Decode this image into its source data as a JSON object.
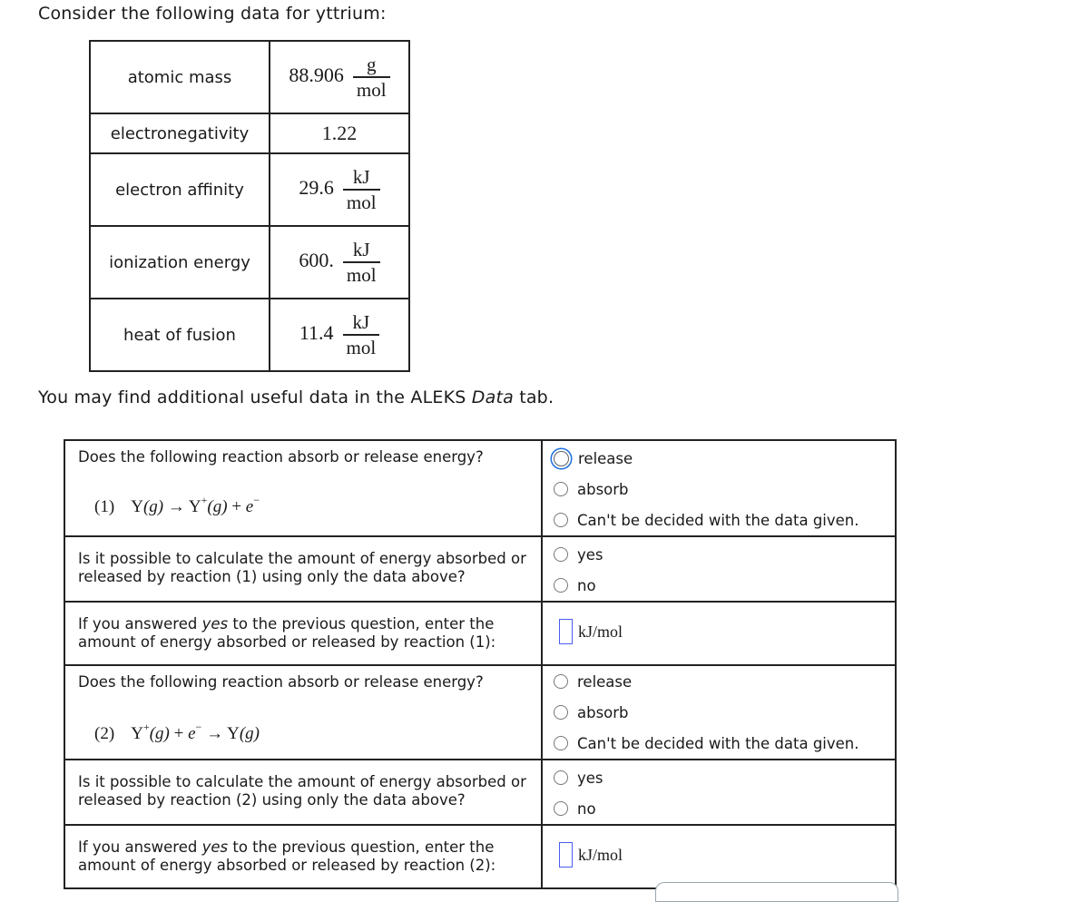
{
  "intro": "Consider the following data for yttrium:",
  "data_table": {
    "rows": [
      {
        "property": "atomic mass",
        "value": "88.906",
        "unit_num": "g",
        "unit_den": "mol"
      },
      {
        "property": "electronegativity",
        "value": "1.22"
      },
      {
        "property": "electron affinity",
        "value": "29.6",
        "unit_num": "kJ",
        "unit_den": "mol"
      },
      {
        "property": "ionization energy",
        "value": "600.",
        "unit_num": "kJ",
        "unit_den": "mol"
      },
      {
        "property": "heat of fusion",
        "value": "11.4",
        "unit_num": "kJ",
        "unit_den": "mol"
      }
    ]
  },
  "note": {
    "before": "You may find additional useful data in the ALEKS ",
    "italic": "Data",
    "after": " tab."
  },
  "questions": [
    {
      "absorb_release": {
        "prompt": "Does the following reaction absorb or release energy?",
        "equation": {
          "label": "(1)",
          "lhs": "Y",
          "lhs_state": "(g)",
          "arrow": "→",
          "rhs_ion": "Y",
          "rhs_ion_charge": "+",
          "rhs_ion_state": "(g)",
          "plus": "+",
          "electron": "e",
          "electron_charge": "−"
        },
        "options": [
          "release",
          "absorb",
          "Can't be decided with the data given."
        ],
        "focused_option": "release"
      },
      "possible": {
        "prompt": "Is it possible to calculate the amount of energy absorbed or released by reaction (1) using only the data above?",
        "options": [
          "yes",
          "no"
        ]
      },
      "amount": {
        "prompt_before": "If you answered ",
        "prompt_italic": "yes",
        "prompt_after": " to the previous question, enter the amount of energy absorbed or released by reaction (1):",
        "value": "",
        "unit": "kJ/mol"
      }
    },
    {
      "absorb_release": {
        "prompt": "Does the following reaction absorb or release energy?",
        "equation": {
          "label": "(2)",
          "lhs": "Y",
          "lhs_charge": "+",
          "lhs_state": "(g)",
          "plus": "+",
          "electron": "e",
          "electron_charge": "−",
          "arrow": "→",
          "rhs": "Y",
          "rhs_state": "(g)"
        },
        "options": [
          "release",
          "absorb",
          "Can't be decided with the data given."
        ]
      },
      "possible": {
        "prompt": "Is it possible to calculate the amount of energy absorbed or released by reaction (2) using only the data above?",
        "options": [
          "yes",
          "no"
        ]
      },
      "amount": {
        "prompt_before": "If you answered ",
        "prompt_italic": "yes",
        "prompt_after": " to the previous question, enter the amount of energy absorbed or released by reaction (2):",
        "value": "",
        "unit": "kJ/mol"
      }
    }
  ]
}
